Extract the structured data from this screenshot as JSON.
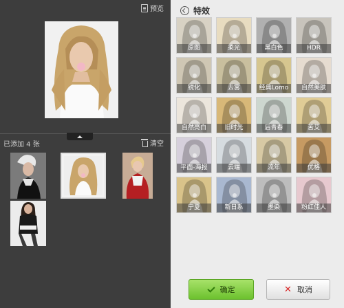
{
  "left_panel": {
    "preview_label": "预览",
    "added_count_text": "已添加 4 张",
    "clear_label": "清空"
  },
  "right_panel": {
    "title": "特效",
    "effects": [
      {
        "label": "原图",
        "tone": "#d8d2c4"
      },
      {
        "label": "柔光",
        "tone": "#e8dcc0"
      },
      {
        "label": "黑白色",
        "tone": "#b0b0b0"
      },
      {
        "label": "HDR",
        "tone": "#c8c4bc"
      },
      {
        "label": "锐化",
        "tone": "#cfc7b4"
      },
      {
        "label": "去雾",
        "tone": "#c9bf9e"
      },
      {
        "label": "经典Lomo",
        "tone": "#d6c68f"
      },
      {
        "label": "自然美肤",
        "tone": "#e6dcd0"
      },
      {
        "label": "自然亮白",
        "tone": "#ece6dc"
      },
      {
        "label": "旧时光",
        "tone": "#d8b878"
      },
      {
        "label": "后青春",
        "tone": "#cdd7cf"
      },
      {
        "label": "苦艾",
        "tone": "#e0cc96"
      },
      {
        "label": "平面-海报",
        "tone": "#d6d0dc"
      },
      {
        "label": "云端",
        "tone": "#d6dce0"
      },
      {
        "label": "流年",
        "tone": "#d7c9a4"
      },
      {
        "label": "优格",
        "tone": "#c69a62"
      },
      {
        "label": "宁夏",
        "tone": "#d9c38a"
      },
      {
        "label": "新日系",
        "tone": "#a9b8d0"
      },
      {
        "label": "墨染",
        "tone": "#bdbdbd"
      },
      {
        "label": "粉红佳人",
        "tone": "#e7c9cf"
      }
    ]
  },
  "buttons": {
    "ok_label": "确定",
    "cancel_label": "取消"
  },
  "colors": {
    "left_bg": "#3d3d3d",
    "right_bg": "#ececec",
    "ok_green": "#6cc12e",
    "cancel_red": "#d82a2a"
  }
}
